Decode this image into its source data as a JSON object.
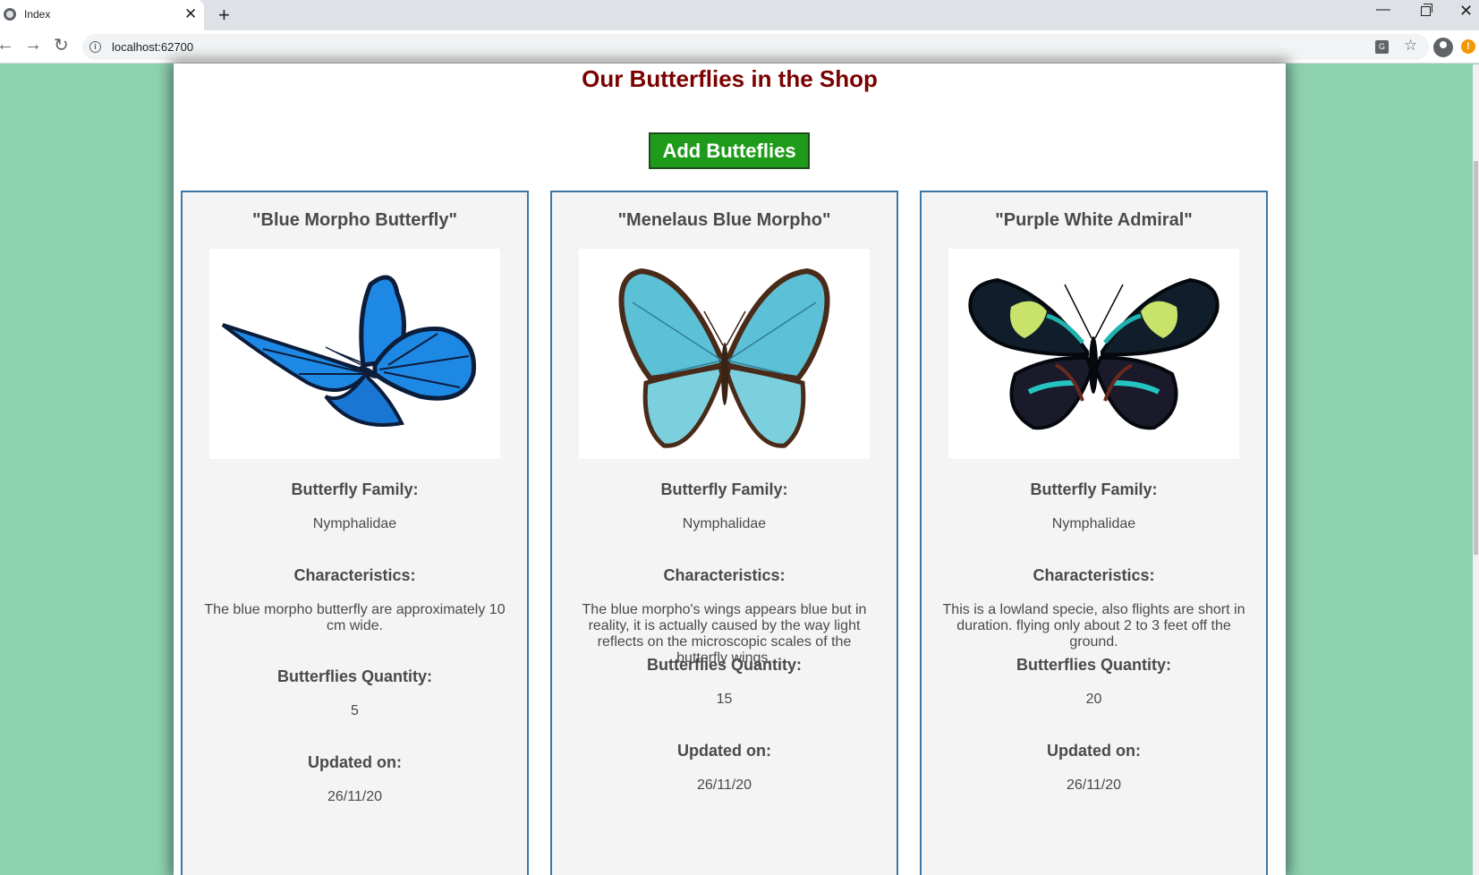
{
  "browser": {
    "tab_title": "Index",
    "close_tab": "✕",
    "new_tab": "+",
    "url": "localhost:62700"
  },
  "page": {
    "title": "Our Butterflies in the Shop",
    "add_button_label": "Add Butteflies"
  },
  "labels": {
    "family": "Butterfly Family:",
    "characteristics": "Characteristics:",
    "quantity": "Butterflies Quantity:",
    "updated": "Updated on:"
  },
  "cards": [
    {
      "name": "\"Blue Morpho Butterfly\"",
      "family": "Nymphalidae",
      "characteristics": "The blue morpho butterfly are approximately 10 cm wide.",
      "quantity": "5",
      "updated": "26/11/20",
      "colors": {
        "wing": "#1e88e5",
        "edge": "#0b1d3a"
      }
    },
    {
      "name": "\"Menelaus Blue Morpho\"",
      "family": "Nymphalidae",
      "characteristics": "The blue morpho's wings appears blue but in reality, it is actually caused by the way light reflects on the microscopic scales of the butterfly wings.",
      "quantity": "15",
      "updated": "26/11/20",
      "colors": {
        "wing": "#5cc0d6",
        "edge": "#4a2a18"
      }
    },
    {
      "name": "\"Purple White Admiral\"",
      "family": "Nymphalidae",
      "characteristics": "This is a lowland specie, also flights are short in duration. flying only about 2 to 3 feet off the ground.",
      "quantity": "20",
      "updated": "26/11/20",
      "colors": {
        "wing": "#0f1e2a",
        "edge": "#c9e36a"
      }
    }
  ]
}
